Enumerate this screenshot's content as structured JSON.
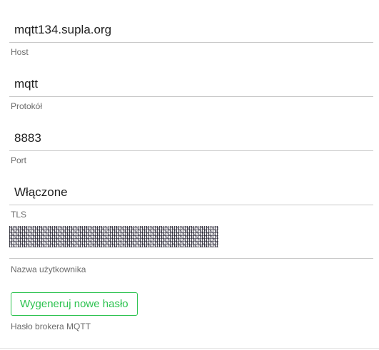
{
  "fields": {
    "host": {
      "value": "mqtt134.supla.org",
      "label": "Host"
    },
    "protocol": {
      "value": "mqtt",
      "label": "Protokół"
    },
    "port": {
      "value": "8883",
      "label": "Port"
    },
    "tls": {
      "value": "Włączone",
      "label": "TLS"
    },
    "username": {
      "value_masked": true,
      "label": "Nazwa użytkownika"
    }
  },
  "password": {
    "generate_button_label": "Wygeneruj nowe hasło",
    "label": "Hasło brokera MQTT"
  },
  "colors": {
    "accent": "#2bc24e",
    "label_text": "#6b6b6b",
    "value_text": "#1e1e1e",
    "divider": "#c8c8c8"
  }
}
